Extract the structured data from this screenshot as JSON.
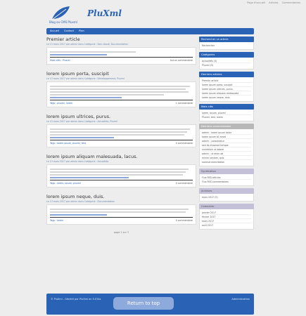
{
  "header": {
    "topbar_links": [
      "Page d'accueil",
      "Articles",
      "Commentaires"
    ],
    "brand": "PluXml",
    "logo_sub": "Blog ou CMS Pluxml"
  },
  "nav": {
    "links": [
      "Accueil",
      "Contact",
      "Plan"
    ]
  },
  "posts": [
    {
      "title": "Premier article",
      "meta": "Le 13 mars 2017 par admin dans Catégorie : Non classé, Documentation",
      "footer_cats": "Mots clés : Pluxml",
      "comments": "Aucun commentaire"
    },
    {
      "title": "lorem ipsum porta, suscipit",
      "meta": "Le 13 mars 2017 par admin dans Catégorie : Développement, Pluxml",
      "footer_cats": "Tags : pluxml, lorem",
      "comments": "1 commentaire"
    },
    {
      "title": "lorem ipsum ultrices, purus.",
      "meta": "Le 13 mars 2017 par admin dans Catégorie : Actualités, Pluxml",
      "footer_cats": "Tags : lorem ipsum, pluxml, test",
      "comments": "0 commentaire"
    },
    {
      "title": "lorem ipsum aliquam malesuada, lacus.",
      "meta": "Le 13 mars 2017 par admin dans Catégorie : Actualités",
      "footer_cats": "Tags : lorem, ipsum, pluxml",
      "comments": "0 commentaire"
    },
    {
      "title": "lorem ipsum neque, duis.",
      "meta": "Le 13 mars 2017 par admin dans Catégorie : Documentation",
      "footer_cats": "Tags : lorem",
      "comments": "0 commentaire"
    }
  ],
  "pagination": "page 1 sur 2",
  "sidebar": [
    {
      "title": "Rechercher un article",
      "style": "blue",
      "items": [
        "Rechercher"
      ]
    },
    {
      "title": "Catégories",
      "style": "blue",
      "items": [
        "Actualités (3)",
        "Pluxml (5)"
      ]
    },
    {
      "title": "Derniers articles",
      "style": "blue",
      "items": [
        "Premier article",
        "lorem ipsum porta, suscipit",
        "lorem ipsum ultrices, purus.",
        "lorem ipsum aliquam malesuada",
        "lorem ipsum neque, duis."
      ]
    },
    {
      "title": "Mots clés",
      "style": "blue",
      "items": [
        "lorem, ipsum, pluxml",
        "Pluxml, test, lorem"
      ]
    },
    {
      "title": "Derniers commentaires",
      "style": "grey",
      "items": [
        "admin : lorem ipsum dolor",
        "lorem ipsum sit amet",
        "admin : consectetur",
        "sed do eiusmod tempor",
        "incididunt ut labore",
        "admin : ut enim ad",
        "minim veniam, quis",
        "nostrud exercitation"
      ]
    },
    {
      "title": "Syndication",
      "style": "lav",
      "items": [
        "Flux RSS articles",
        "Flux RSS commentaires"
      ]
    },
    {
      "title": "Archives",
      "style": "lav",
      "items": [
        "mars 2017 (5)"
      ]
    },
    {
      "title": "Calendrier",
      "style": "lav",
      "items": [
        "janvier 2017",
        "février 2017",
        "mars 2017",
        "avril 2017"
      ]
    }
  ],
  "footer": {
    "text": "© PluXml - Généré par PluXml en 0.034s",
    "right": "Administration",
    "return_top": "Return to top"
  }
}
